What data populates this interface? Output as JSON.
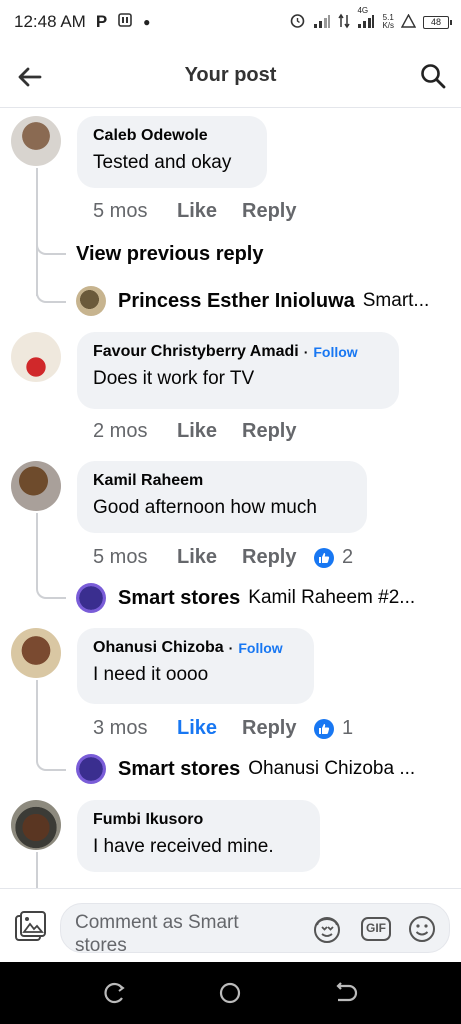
{
  "status_bar": {
    "time": "12:48 AM",
    "net_4g": "4G",
    "speed_top": "5.1",
    "speed_bottom": "K/s",
    "battery": "48",
    "icons": [
      "p-app-icon",
      "sim-icon",
      "dot-icon",
      "alarm-icon",
      "signal-icon",
      "data-arrows-icon",
      "signal-4g-icon",
      "warning-icon",
      "battery-icon"
    ]
  },
  "header": {
    "title": "Your post",
    "back_icon": "arrow-left-icon",
    "search_icon": "search-icon"
  },
  "comments": [
    {
      "author": "Caleb Odewole",
      "text": "Tested and okay",
      "age": "5 mos",
      "like": "Like",
      "reply": "Reply",
      "view_previous": "View previous reply",
      "replies": [
        {
          "name": "Princess Esther Inioluwa",
          "snippet": "Smart..."
        }
      ]
    },
    {
      "author": "Favour Christyberry Amadi",
      "follow": "Follow",
      "text": "Does it work for TV",
      "age": "2 mos",
      "like": "Like",
      "reply": "Reply"
    },
    {
      "author": "Kamil Raheem",
      "text": "Good afternoon how much",
      "age": "5 mos",
      "like": "Like",
      "reply": "Reply",
      "reaction_count": "2",
      "replies": [
        {
          "name": "Smart stores",
          "snippet": "Kamil Raheem #2..."
        }
      ]
    },
    {
      "author": "Ohanusi Chizoba",
      "follow": "Follow",
      "text": "I need it oooo",
      "age": "3 mos",
      "like": "Like",
      "reply": "Reply",
      "reaction_count": "1",
      "liked": true,
      "replies": [
        {
          "name": "Smart stores",
          "snippet": "Ohanusi Chizoba ..."
        }
      ]
    },
    {
      "author": "Fumbi Ikusoro",
      "text": "I have  received  mine."
    }
  ],
  "composer": {
    "placeholder": "Comment as Smart stores",
    "icons": [
      "gallery-icon",
      "avatar-sticker-icon",
      "gif-icon",
      "emoji-icon"
    ],
    "gif_label": "GIF"
  },
  "nav_bar": {
    "icons": [
      "recent-apps-icon",
      "home-icon",
      "back-icon"
    ]
  },
  "colors": {
    "accent": "#1877f2",
    "bubble": "#f0f2f5",
    "meta_text": "#65676b"
  }
}
